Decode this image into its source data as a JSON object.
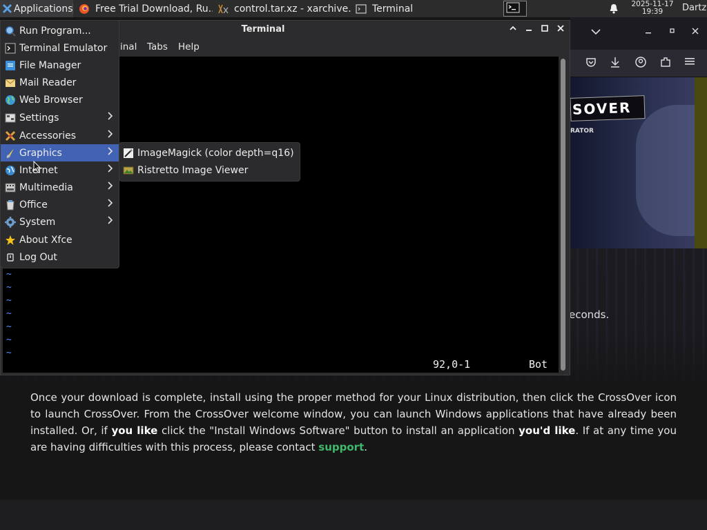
{
  "taskbar": {
    "applications_label": "Applications",
    "windows": [
      {
        "title": "Free Trial Download, Ru...",
        "icon": "firefox-icon"
      },
      {
        "title": "control.tar.xz - xarchive...",
        "icon": "archive-icon"
      },
      {
        "title": "Terminal",
        "icon": "terminal-icon"
      }
    ],
    "clock": {
      "date": "2025-11-17",
      "time": "19:39"
    },
    "user": "Dartz"
  },
  "terminal": {
    "title": "Terminal",
    "menu": {
      "terminal_partial": "inal",
      "tabs": "Tabs",
      "help": "Help"
    },
    "tilde": "~",
    "status_position": "92,0-1",
    "status_scroll": "Bot"
  },
  "app_menu": {
    "items": [
      {
        "label": "Run Program...",
        "icon": "run-program-icon",
        "submenu": false
      },
      {
        "label": "Terminal Emulator",
        "icon": "terminal-emulator-icon",
        "submenu": false
      },
      {
        "label": "File Manager",
        "icon": "file-manager-icon",
        "submenu": false
      },
      {
        "label": "Mail Reader",
        "icon": "mail-reader-icon",
        "submenu": false
      },
      {
        "label": "Web Browser",
        "icon": "web-browser-icon",
        "submenu": false
      },
      {
        "label": "Settings",
        "icon": "settings-icon",
        "submenu": true
      },
      {
        "label": "Accessories",
        "icon": "accessories-icon",
        "submenu": true
      },
      {
        "label": "Graphics",
        "icon": "graphics-icon",
        "submenu": true
      },
      {
        "label": "Internet",
        "icon": "internet-icon",
        "submenu": true
      },
      {
        "label": "Multimedia",
        "icon": "multimedia-icon",
        "submenu": true
      },
      {
        "label": "Office",
        "icon": "office-icon",
        "submenu": true
      },
      {
        "label": "System",
        "icon": "system-icon",
        "submenu": true
      },
      {
        "label": "About Xfce",
        "icon": "about-xfce-icon",
        "submenu": false
      },
      {
        "label": "Log Out",
        "icon": "log-out-icon",
        "submenu": false
      }
    ],
    "active_item": "Graphics"
  },
  "graphics_submenu": {
    "items": [
      {
        "label": "ImageMagick (color depth=q16)",
        "icon": "imagemagick-icon"
      },
      {
        "label": "Ristretto Image Viewer",
        "icon": "ristretto-icon"
      }
    ]
  },
  "browser": {
    "banner_logo": "SOVER",
    "banner_sub": "RATOR"
  },
  "page": {
    "seconds_fragment": "econds.",
    "para": {
      "p1": "Once your download is complete, install using the proper method for your Linux distribution, then click the CrossOver icon to launch CrossOver. From the CrossOver welcome window, you can launch Windows applications that have already been installed. Or, if ",
      "b1": "you like",
      "p2": " click the \"Install Windows Software\" button to install an application ",
      "b2": "you'd like",
      "p3": ". If at any time you are having difficulties with this process, please contact ",
      "link": "support",
      "p4": "."
    }
  },
  "colors": {
    "menu_highlight": "#4263b4",
    "vim_tilde": "#5c8eff",
    "link_green": "#3fb86b"
  }
}
